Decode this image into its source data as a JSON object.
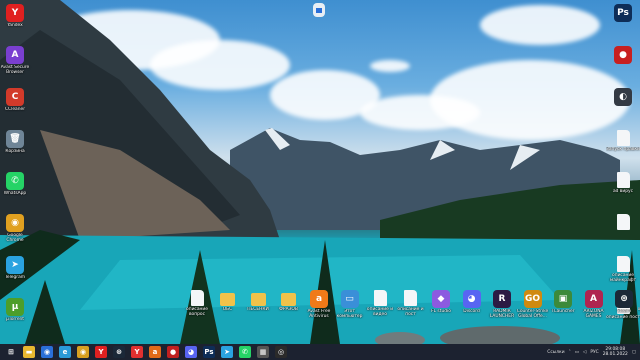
{
  "desktop_left": [
    {
      "label": "Yandex",
      "icon": "yandex-icon",
      "glyph": "Y",
      "color": "#e02020"
    },
    {
      "label": "Avast Secure Browser",
      "icon": "avast-browser-icon",
      "glyph": "A",
      "color": "#7a3fd0"
    },
    {
      "label": "CCleaner",
      "icon": "ccleaner-icon",
      "glyph": "C",
      "color": "#d23a2a"
    },
    {
      "label": "Корзина",
      "icon": "recycle-bin-icon",
      "glyph": "🗑",
      "color": "#6f8597"
    },
    {
      "label": "WhatsApp",
      "icon": "whatsapp-icon",
      "glyph": "✆",
      "color": "#25d366"
    },
    {
      "label": "Google Chrome",
      "icon": "chrome-icon",
      "glyph": "◉",
      "color": "#e0a020"
    },
    {
      "label": "Telegram",
      "icon": "telegram-icon",
      "glyph": "➤",
      "color": "#2aa3e0"
    },
    {
      "label": "µTorrent",
      "icon": "utorrent-icon",
      "glyph": "µ",
      "color": "#4c9e2a"
    }
  ],
  "desktop_right": [
    {
      "label": "",
      "icon": "photoshop-icon",
      "glyph": "Ps",
      "color": "#0e2d57"
    },
    {
      "label": "",
      "icon": "app-red-icon",
      "glyph": "●",
      "color": "#c82020"
    },
    {
      "label": "",
      "icon": "app-dark-icon",
      "glyph": "◐",
      "color": "#333a44"
    },
    {
      "label": "Запуск правки",
      "icon": "document-icon",
      "glyph": "",
      "color": "#f4f6f8"
    },
    {
      "label": "ad вирус",
      "icon": "document-icon",
      "glyph": "",
      "color": "#f4f6f8"
    },
    {
      "label": "",
      "icon": "document-icon",
      "glyph": "",
      "color": "#f4f6f8"
    },
    {
      "label": "описание майнкрафт",
      "icon": "document-icon",
      "glyph": "",
      "color": "#f4f6f8"
    },
    {
      "label": "описание пост",
      "icon": "document-icon",
      "glyph": "",
      "color": "#f4f6f8"
    }
  ],
  "desktop_top": {
    "label": "",
    "icon": "file-icon"
  },
  "desktop_bottom": [
    {
      "label": "описание вопрос",
      "icon": "document-icon",
      "glyph": "",
      "color": "#f4f6f8",
      "kind": "doc"
    },
    {
      "label": "ОБС",
      "icon": "folder-icon",
      "glyph": "",
      "color": "#f0c24a",
      "kind": "folder"
    },
    {
      "label": "ПЕСЕНКИ",
      "icon": "folder-icon",
      "glyph": "",
      "color": "#f0c24a",
      "kind": "folder"
    },
    {
      "label": "ФРАЗОВ",
      "icon": "folder-icon",
      "glyph": "",
      "color": "#f0c24a",
      "kind": "folder"
    },
    {
      "label": "Avast Free Antivirus",
      "icon": "avast-icon",
      "glyph": "a",
      "color": "#f07a18",
      "kind": "app"
    },
    {
      "label": "Этот компьютер",
      "icon": "computer-icon",
      "glyph": "▭",
      "color": "#3a8fd8",
      "kind": "app"
    },
    {
      "label": "описание и видео",
      "icon": "document-icon",
      "glyph": "",
      "color": "#f4f6f8",
      "kind": "doc"
    },
    {
      "label": "описание и пост",
      "icon": "document-icon",
      "glyph": "",
      "color": "#f4f6f8",
      "kind": "doc"
    },
    {
      "label": "FL studio",
      "icon": "fl-studio-icon",
      "glyph": "◆",
      "color": "#8c5ae0",
      "kind": "app"
    },
    {
      "label": "Discord",
      "icon": "discord-icon",
      "glyph": "◕",
      "color": "#5865f2",
      "kind": "app"
    },
    {
      "label": "RADMIR LAUNCHER",
      "icon": "radmir-icon",
      "glyph": "R",
      "color": "#2c1a44",
      "kind": "app"
    },
    {
      "label": "Counter-Strike Global Offe...",
      "icon": "csgo-icon",
      "glyph": "GO",
      "color": "#d08a10",
      "kind": "app"
    },
    {
      "label": "TLauncher",
      "icon": "tlauncher-icon",
      "glyph": "▣",
      "color": "#3c8a3a",
      "kind": "app"
    },
    {
      "label": "ARIZONA GAMES",
      "icon": "arizona-icon",
      "glyph": "A",
      "color": "#b02450",
      "kind": "app"
    },
    {
      "label": "Steam",
      "icon": "steam-icon",
      "glyph": "⊛",
      "color": "#1b2838",
      "kind": "app"
    },
    {
      "label": "описание пост",
      "icon": "document-icon",
      "glyph": "",
      "color": "#f4f6f8",
      "kind": "doc"
    }
  ],
  "taskbar": {
    "apps": [
      {
        "icon": "start-icon",
        "glyph": "⊞",
        "color": "#1c2230"
      },
      {
        "icon": "file-explorer-icon",
        "glyph": "▬",
        "color": "#e8b830"
      },
      {
        "icon": "taskbar-app-icon",
        "glyph": "◉",
        "color": "#2a6fd8"
      },
      {
        "icon": "edge-icon",
        "glyph": "e",
        "color": "#2a9ad8"
      },
      {
        "icon": "chrome-icon",
        "glyph": "◉",
        "color": "#d8a020"
      },
      {
        "icon": "yandex-icon",
        "glyph": "Y",
        "color": "#e02020"
      },
      {
        "icon": "steam-icon",
        "glyph": "⊛",
        "color": "#1b2838"
      },
      {
        "icon": "yandex-browser-icon",
        "glyph": "Y",
        "color": "#e03030"
      },
      {
        "icon": "avast-icon",
        "glyph": "a",
        "color": "#e06a18"
      },
      {
        "icon": "app-red-icon",
        "glyph": "●",
        "color": "#c02020"
      },
      {
        "icon": "discord-icon",
        "glyph": "◕",
        "color": "#5865f2"
      },
      {
        "icon": "photoshop-icon",
        "glyph": "Ps",
        "color": "#0e2d57"
      },
      {
        "icon": "telegram-icon",
        "glyph": "➤",
        "color": "#2aa3e0"
      },
      {
        "icon": "whatsapp-icon",
        "glyph": "✆",
        "color": "#25d366"
      },
      {
        "icon": "app-icon",
        "glyph": "▦",
        "color": "#555"
      },
      {
        "icon": "app-icon-2",
        "glyph": "◎",
        "color": "#2a2a2a"
      }
    ],
    "tray": {
      "links_label": "Ссылки",
      "lang": "РУС",
      "time": "29:08:08",
      "date": "28.01.2022"
    }
  }
}
